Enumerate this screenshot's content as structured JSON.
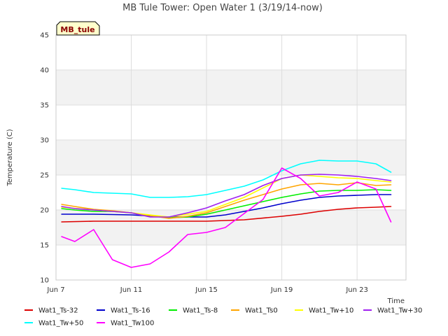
{
  "chart_data": {
    "type": "line",
    "title": "MB Tule Tower: Open Water 1 (3/19/14-now)",
    "xlabel": "Time",
    "ylabel": "Temperature (C)",
    "station_label": "MB_tule",
    "xlim": [
      0,
      18.6
    ],
    "ylim": [
      10,
      45
    ],
    "x_ticks": [
      {
        "value": 0,
        "label": "Jun 7"
      },
      {
        "value": 4,
        "label": "Jun 11"
      },
      {
        "value": 8,
        "label": "Jun 15"
      },
      {
        "value": 12,
        "label": "Jun 19"
      },
      {
        "value": 16,
        "label": "Jun 23"
      }
    ],
    "y_ticks": [
      10,
      15,
      20,
      25,
      30,
      35,
      40,
      45
    ],
    "grid": true,
    "legend_position": "bottom",
    "series": [
      {
        "name": "Wat1_Ts-32",
        "color": "#dd0000",
        "x": [
          0.3,
          2,
          4,
          6,
          8,
          10,
          12,
          13,
          14,
          15,
          16,
          17,
          17.8
        ],
        "y": [
          18.3,
          18.4,
          18.4,
          18.4,
          18.4,
          18.6,
          19.1,
          19.4,
          19.8,
          20.1,
          20.3,
          20.4,
          20.5
        ]
      },
      {
        "name": "Wat1_Ts-16",
        "color": "#0000cc",
        "x": [
          0.3,
          2,
          4,
          6,
          8,
          9,
          10,
          11,
          12,
          13,
          14,
          15,
          16,
          17,
          17.8
        ],
        "y": [
          19.4,
          19.4,
          19.3,
          19.0,
          19.0,
          19.3,
          19.8,
          20.3,
          20.9,
          21.4,
          21.8,
          22.0,
          22.1,
          22.2,
          22.2
        ]
      },
      {
        "name": "Wat1_Ts-8",
        "color": "#00ee00",
        "x": [
          0.3,
          1,
          2,
          3,
          4,
          5,
          6,
          7,
          8,
          9,
          10,
          11,
          12,
          13,
          14,
          15,
          16,
          17,
          17.8
        ],
        "y": [
          20.2,
          20.0,
          19.8,
          19.8,
          19.6,
          19.2,
          18.9,
          19.0,
          19.4,
          20.0,
          20.6,
          21.2,
          21.8,
          22.3,
          22.7,
          22.8,
          22.8,
          22.9,
          22.8
        ]
      },
      {
        "name": "Wat1_Ts0",
        "color": "#ffa500",
        "x": [
          0.3,
          1,
          2,
          3,
          4,
          5,
          6,
          7,
          8,
          9,
          10,
          11,
          12,
          13,
          14,
          15,
          16,
          17,
          17.8
        ],
        "y": [
          20.8,
          20.5,
          20.1,
          19.9,
          19.6,
          19.2,
          18.8,
          19.1,
          19.6,
          20.5,
          21.4,
          22.2,
          23.0,
          23.6,
          23.8,
          23.6,
          23.9,
          23.5,
          23.6
        ]
      },
      {
        "name": "Wat1_Tw+10",
        "color": "#ffff00",
        "x": [
          0.3,
          2,
          4,
          6,
          8,
          10,
          12,
          13,
          14,
          15,
          16,
          17,
          17.8
        ],
        "y": [
          20.4,
          20.0,
          19.6,
          19.0,
          19.8,
          21.8,
          24.5,
          25.0,
          24.8,
          24.6,
          24.5,
          24.2,
          24.0
        ]
      },
      {
        "name": "Wat1_Tw+30",
        "color": "#a020f0",
        "x": [
          0.3,
          1,
          2,
          3,
          4,
          5,
          6,
          7,
          8,
          9,
          10,
          11,
          12,
          13,
          14,
          15,
          16,
          17,
          17.8
        ],
        "y": [
          20.5,
          20.2,
          20.0,
          19.8,
          19.6,
          19.0,
          19.0,
          19.6,
          20.3,
          21.3,
          22.2,
          23.5,
          24.5,
          25.0,
          25.1,
          25.0,
          24.8,
          24.5,
          24.2
        ]
      },
      {
        "name": "Wat1_Tw+50",
        "color": "#00ffff",
        "x": [
          0.3,
          1,
          2,
          3,
          4,
          5,
          6,
          7,
          8,
          9,
          10,
          11,
          12,
          13,
          14,
          15,
          16,
          17,
          17.8
        ],
        "y": [
          23.1,
          22.9,
          22.5,
          22.4,
          22.3,
          21.8,
          21.8,
          21.9,
          22.2,
          22.8,
          23.4,
          24.3,
          25.6,
          26.6,
          27.1,
          27.0,
          27.0,
          26.6,
          25.4
        ]
      },
      {
        "name": "Wat1_Tw100",
        "color": "#ff00ff",
        "x": [
          0.3,
          1,
          2,
          3,
          4,
          5,
          6,
          7,
          8,
          9,
          10,
          11,
          12,
          13,
          14,
          15,
          16,
          17,
          17.8
        ],
        "y": [
          16.2,
          15.5,
          17.2,
          12.9,
          11.8,
          12.3,
          14.0,
          16.5,
          16.8,
          17.5,
          19.5,
          21.5,
          26.0,
          24.5,
          22.0,
          22.5,
          24.0,
          23.0,
          18.3
        ]
      }
    ]
  }
}
